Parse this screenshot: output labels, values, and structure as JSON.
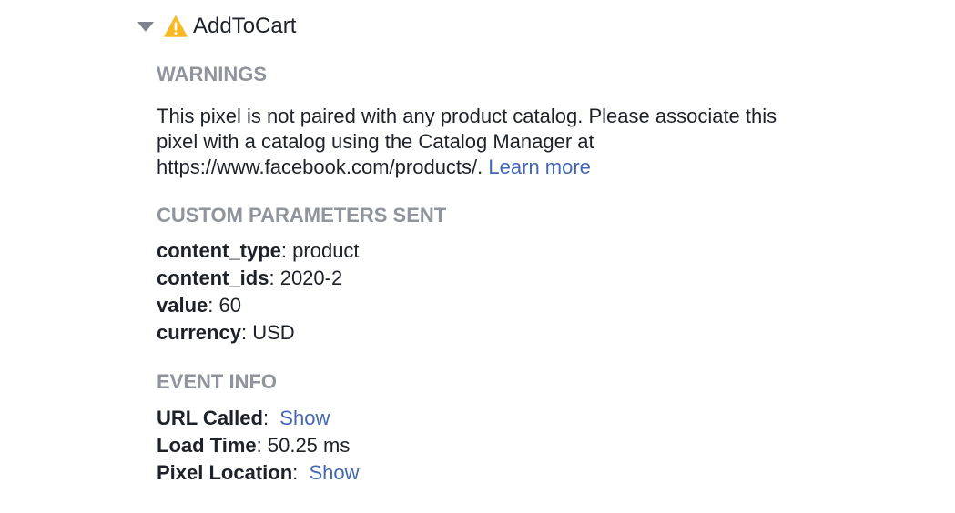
{
  "event": {
    "name": "AddToCart",
    "icons": {
      "toggle": "caret-down-icon",
      "status": "warning-triangle-icon",
      "warning_color": "#f7b928"
    }
  },
  "warnings": {
    "heading": "WARNINGS",
    "text": "This pixel is not paired with any product catalog. Please associate this pixel with a catalog using the Catalog Manager at https://www.facebook.com/products/.",
    "learn_more": "Learn more"
  },
  "custom_parameters": {
    "heading": "CUSTOM PARAMETERS SENT",
    "items": [
      {
        "key": "content_type",
        "value": "product"
      },
      {
        "key": "content_ids",
        "value": "2020-2"
      },
      {
        "key": "value",
        "value": "60"
      },
      {
        "key": "currency",
        "value": "USD"
      }
    ]
  },
  "event_info": {
    "heading": "EVENT INFO",
    "url_called": {
      "key": "URL Called",
      "link": "Show"
    },
    "load_time": {
      "key": "Load Time",
      "value": "50.25 ms"
    },
    "pixel_location": {
      "key": "Pixel Location",
      "link": "Show"
    }
  },
  "colors": {
    "heading": "#90949c",
    "text": "#1d2129",
    "link": "#4267b2"
  }
}
